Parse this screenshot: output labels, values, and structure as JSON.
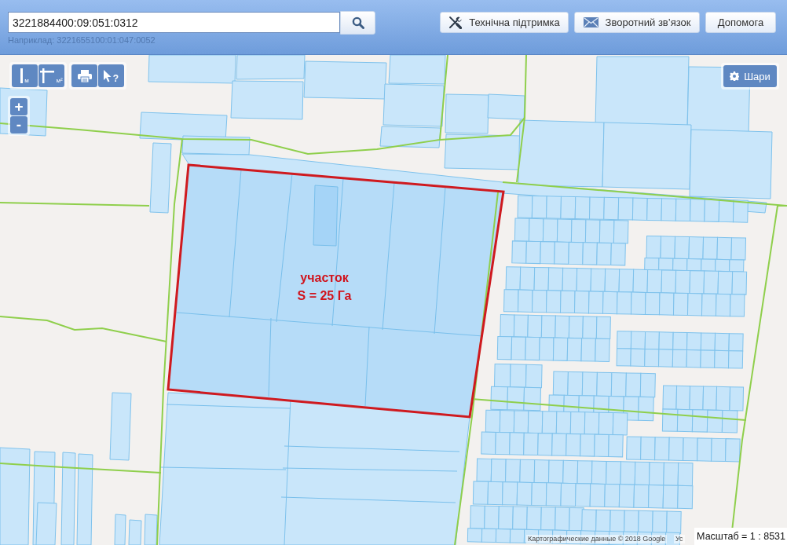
{
  "search": {
    "value": "3221884400:09:051:0312",
    "hint": "Наприклад: 3221655100:01:047:0052"
  },
  "header_buttons": [
    {
      "kind": "tools",
      "label": "Технічна підтримка"
    },
    {
      "kind": "mail",
      "label": "Зворотний зв’язок"
    },
    {
      "kind": "text",
      "label": "Допомога"
    }
  ],
  "map": {
    "tool_groups": [
      {
        "tools": [
          {
            "kind": "ruler",
            "label": "м"
          },
          {
            "kind": "area",
            "label": "м²"
          }
        ]
      },
      {
        "tools": [
          {
            "kind": "print"
          },
          {
            "kind": "info",
            "label": "?"
          }
        ]
      }
    ],
    "zoom_controls": [
      {
        "label": "+"
      },
      {
        "label": "-"
      }
    ],
    "layers_button": {
      "label": "Шари"
    },
    "plot_label": [
      "участок",
      "S = 25 Га"
    ],
    "attribution": [
      "Картографические данные © 2018 Google",
      "Ус"
    ],
    "scale": "Масштаб = 1 : 8531"
  }
}
